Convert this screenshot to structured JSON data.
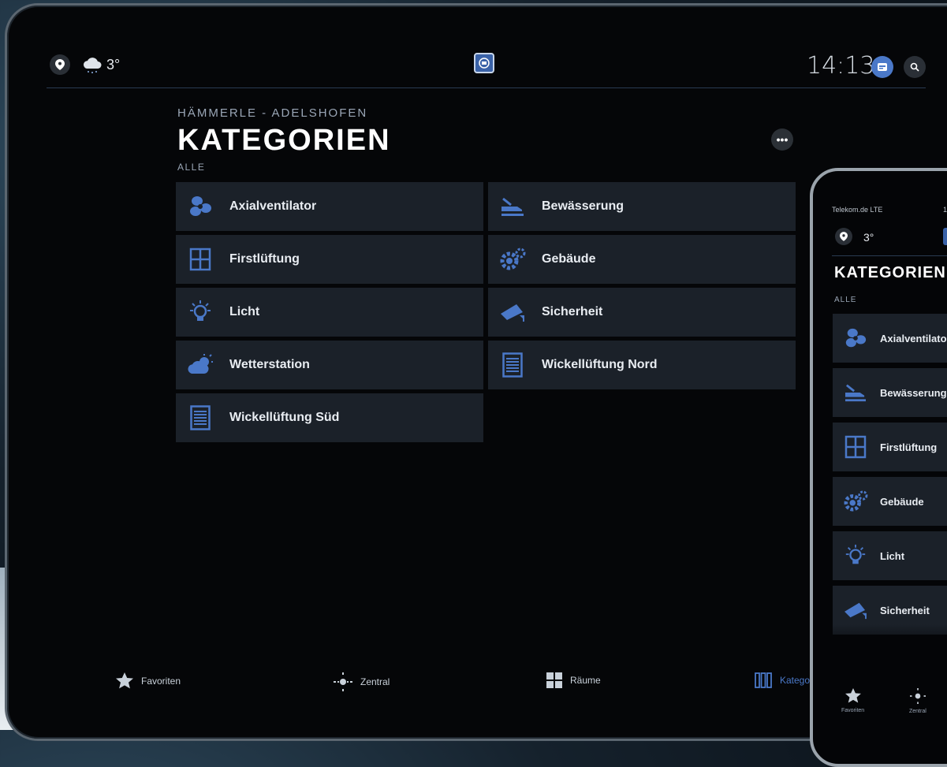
{
  "tablet": {
    "topbar": {
      "temperature": "3°",
      "time": "14:13",
      "icons": [
        "location-pin-icon",
        "cloud-snow-icon",
        "app-logo-icon",
        "display-icon",
        "search-icon"
      ]
    },
    "header": {
      "subtitle": "HÄMMERLE - ADELSHOFEN",
      "title": "KATEGORIEN",
      "filter": "ALLE",
      "more_label": "•••"
    },
    "categories": [
      {
        "label": "Axialventilator",
        "icon": "fan-icon"
      },
      {
        "label": "Bewässerung",
        "icon": "irrigation-icon"
      },
      {
        "label": "Firstlüftung",
        "icon": "window-icon"
      },
      {
        "label": "Gebäude",
        "icon": "gears-icon"
      },
      {
        "label": "Licht",
        "icon": "light-bulb-icon"
      },
      {
        "label": "Sicherheit",
        "icon": "security-camera-icon"
      },
      {
        "label": "Wetterstation",
        "icon": "weather-icon"
      },
      {
        "label": "Wickellüftung Nord",
        "icon": "blind-icon"
      },
      {
        "label": "Wickellüftung Süd",
        "icon": "blind-icon"
      }
    ],
    "bottom_nav": [
      {
        "label": "Favoriten",
        "icon": "star-icon"
      },
      {
        "label": "Zentral",
        "icon": "crosshair-icon"
      },
      {
        "label": "Räume",
        "icon": "rooms-grid-icon"
      },
      {
        "label": "Katego",
        "icon": "categories-icon"
      }
    ],
    "colors": {
      "accent": "#4a78c8",
      "tile": "#1b2129",
      "background": "#050608"
    }
  },
  "phone": {
    "status_left": "Telekom.de  LTE",
    "status_right": "1",
    "temperature": "3°",
    "title": "KATEGORIEN",
    "filter": "ALLE",
    "categories": [
      {
        "label": "Axialventilator"
      },
      {
        "label": "Bewässerung"
      },
      {
        "label": "Firstlüftung"
      },
      {
        "label": "Gebäude"
      },
      {
        "label": "Licht"
      },
      {
        "label": "Sicherheit"
      }
    ],
    "bottom_nav": [
      {
        "label": "Favoriten"
      },
      {
        "label": "Zentral"
      }
    ]
  }
}
